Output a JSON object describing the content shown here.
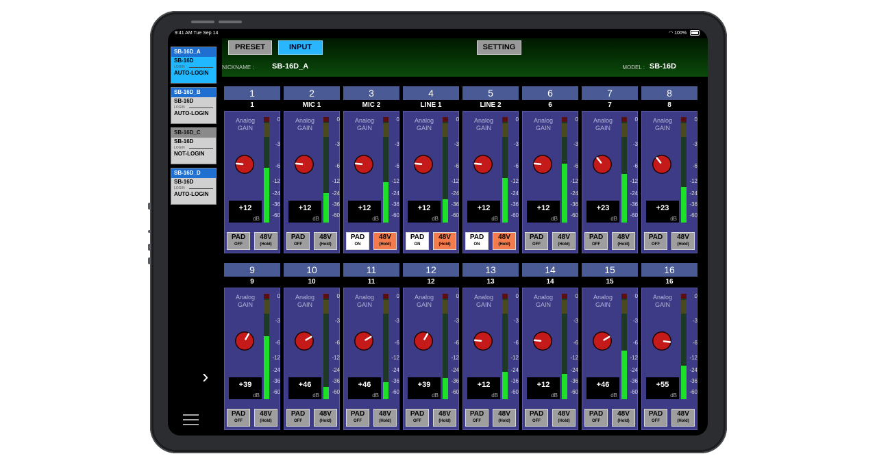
{
  "status_bar": {
    "time": "9:41 AM  Tue Sep 14",
    "battery": "100%"
  },
  "devices": [
    {
      "name": "SB-16D_A",
      "model": "SB-16D",
      "login_label": "LOGIN",
      "state": "AUTO-LOGIN",
      "selected": true
    },
    {
      "name": "SB-16D_B",
      "model": "SB-16D",
      "login_label": "LOGIN",
      "state": "AUTO-LOGIN",
      "selected": false
    },
    {
      "name": "SB-16D_C",
      "model": "SB-16D",
      "login_label": "LOGIN",
      "state": "NOT-LOGIN",
      "selected": false
    },
    {
      "name": "SB-16D_D",
      "model": "SB-16D",
      "login_label": "LOGIN",
      "state": "AUTO-LOGIN",
      "selected": false
    }
  ],
  "tabs": {
    "preset": "PRESET",
    "input": "INPUT",
    "setting": "SETTING"
  },
  "info": {
    "nickname_label": "NICKNAME :",
    "nickname": "SB-16D_A",
    "model_label": "MODEL :",
    "model": "SB-16D"
  },
  "channel_labels": {
    "gain": "Analog\nGAIN",
    "db": "dB",
    "pad": "PAD",
    "phantom": "48V",
    "phantom_sub": "(Hold)",
    "scale": [
      "0",
      "-3",
      "-6",
      "-12",
      "-24",
      "-36",
      "-60"
    ]
  },
  "channels": [
    {
      "num": "1",
      "name": "1",
      "gain": "+12",
      "pad": "OFF",
      "phantom_on": false,
      "level": 0.52
    },
    {
      "num": "2",
      "name": "MIC 1",
      "gain": "+12",
      "pad": "OFF",
      "phantom_on": false,
      "level": 0.28
    },
    {
      "num": "3",
      "name": "MIC 2",
      "gain": "+12",
      "pad": "ON",
      "phantom_on": true,
      "level": 0.38
    },
    {
      "num": "4",
      "name": "LINE 1",
      "gain": "+12",
      "pad": "ON",
      "phantom_on": true,
      "level": 0.22
    },
    {
      "num": "5",
      "name": "LINE 2",
      "gain": "+12",
      "pad": "ON",
      "phantom_on": true,
      "level": 0.42
    },
    {
      "num": "6",
      "name": "6",
      "gain": "+12",
      "pad": "OFF",
      "phantom_on": false,
      "level": 0.56
    },
    {
      "num": "7",
      "name": "7",
      "gain": "+23",
      "pad": "OFF",
      "phantom_on": false,
      "level": 0.46
    },
    {
      "num": "8",
      "name": "8",
      "gain": "+23",
      "pad": "OFF",
      "phantom_on": false,
      "level": 0.34
    },
    {
      "num": "9",
      "name": "9",
      "gain": "+39",
      "pad": "OFF",
      "phantom_on": false,
      "level": 0.6
    },
    {
      "num": "10",
      "name": "10",
      "gain": "+46",
      "pad": "OFF",
      "phantom_on": false,
      "level": 0.12
    },
    {
      "num": "11",
      "name": "11",
      "gain": "+46",
      "pad": "OFF",
      "phantom_on": false,
      "level": 0.16
    },
    {
      "num": "12",
      "name": "12",
      "gain": "+39",
      "pad": "OFF",
      "phantom_on": false,
      "level": 0.2
    },
    {
      "num": "13",
      "name": "13",
      "gain": "+12",
      "pad": "OFF",
      "phantom_on": false,
      "level": 0.26
    },
    {
      "num": "14",
      "name": "14",
      "gain": "+12",
      "pad": "OFF",
      "phantom_on": false,
      "level": 0.24
    },
    {
      "num": "15",
      "name": "15",
      "gain": "+46",
      "pad": "OFF",
      "phantom_on": false,
      "level": 0.46
    },
    {
      "num": "16",
      "name": "16",
      "gain": "+55",
      "pad": "OFF",
      "phantom_on": false,
      "level": 0.32
    }
  ],
  "colors": {
    "accent": "#2ab6ff",
    "panel": "#3d3b86",
    "knob": "#c41a1a",
    "meter": "#1ee02a",
    "hold_on": "#f47c4c"
  }
}
